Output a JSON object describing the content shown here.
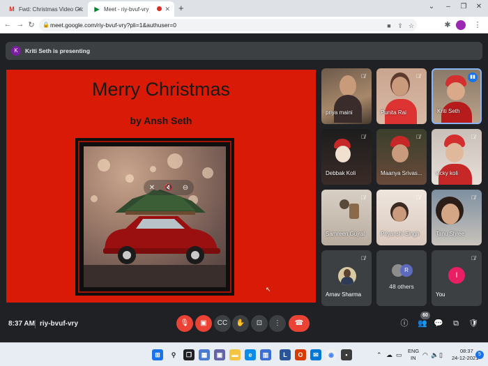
{
  "browser": {
    "tabs": [
      {
        "title": "Fwd: Christmas Video Group A ...",
        "favicon": "gmail-icon",
        "active": false
      },
      {
        "title": "Meet - riy-bvuf-vry",
        "favicon": "meet-icon",
        "active": true
      }
    ],
    "new_tab_label": "+",
    "url": "meet.google.com/riy-bvuf-vry?pli=1&authuser=0"
  },
  "presenting_banner": {
    "avatar_letter": "K",
    "text": "Kriti Seth is presenting"
  },
  "presentation": {
    "title": "Merry Christmas",
    "subtitle": "by Ansh Seth",
    "background_color": "#d91a06"
  },
  "participants": [
    {
      "name": "priya maini",
      "muted": true
    },
    {
      "name": "Punita Rai",
      "muted": true
    },
    {
      "name": "Kriti Seth",
      "muted": false,
      "speaking": true
    },
    {
      "name": "Debbak Koli",
      "muted": true
    },
    {
      "name": "Maanya Srivas...",
      "muted": true
    },
    {
      "name": "vicky koli",
      "muted": true
    },
    {
      "name": "Samreen Gujral",
      "muted": true
    },
    {
      "name": "Priyanshi Singh",
      "muted": true
    },
    {
      "name": "Tanu Shree",
      "muted": true
    },
    {
      "name": "Arnav Sharma",
      "muted": true
    },
    {
      "name": "48 others",
      "avatar_letter": "R"
    },
    {
      "name": "You",
      "avatar_letter": "I",
      "muted": true
    }
  ],
  "meeting_bar": {
    "time": "8:37 AM",
    "meeting_code": "riy-bvuf-vry",
    "participant_count": "60"
  },
  "taskbar": {
    "language": "ENG",
    "region": "IN",
    "clock_time": "08:37",
    "clock_date": "24-12-2021",
    "notification_count": "5"
  }
}
